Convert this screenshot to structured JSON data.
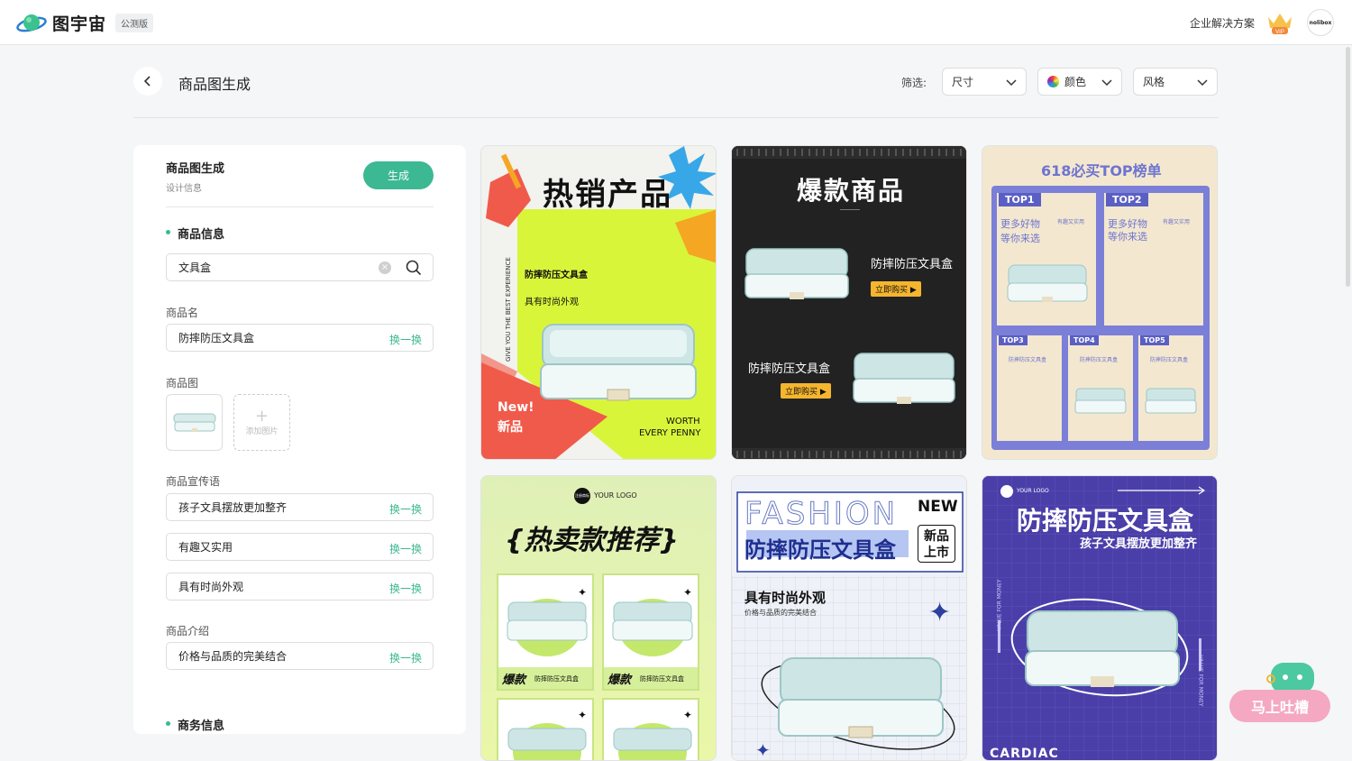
{
  "header": {
    "logo_text": "图宇宙",
    "beta_badge": "公测版",
    "enterprise_link": "企业解决方案",
    "vip_badge": "VIP",
    "avatar_text": "nolibox"
  },
  "toolbar": {
    "page_title": "商品图生成",
    "filter_label": "筛选:",
    "filters": [
      "尺寸",
      "颜色",
      "风格"
    ]
  },
  "panel": {
    "title": "商品图生成",
    "subtitle": "设计信息",
    "generate_label": "生成",
    "product_section": "商品信息",
    "search_value": "文具盒",
    "name_label": "商品名",
    "name_value": "防摔防压文具盒",
    "swap_label": "换一换",
    "image_label": "商品图",
    "add_image_label": "添加图片",
    "slogan_label": "商品宣传语",
    "slogans": [
      "孩子文具摆放更加整齐",
      "有趣又实用",
      "具有时尚外观"
    ],
    "intro_label": "商品介绍",
    "intro_value": "价格与品质的完美结合",
    "business_section": "商务信息"
  },
  "cards": {
    "c1": {
      "title": "热销产品",
      "vertical": "GIVE YOU THE BEST EXPERIENCE",
      "name": "防摔防压文具盒",
      "tagline": "具有时尚外观",
      "new_en": "New!",
      "new_cn": "新品",
      "worth1": "WORTH",
      "worth2": "EVERY PENNY"
    },
    "c2": {
      "title": "爆款商品",
      "name": "防摔防压文具盒",
      "buy": "立即购买 ▶"
    },
    "c3": {
      "title": "618必买TOP榜单",
      "top1": "TOP1",
      "top2": "TOP2",
      "top3": "TOP3",
      "top4": "TOP4",
      "top5": "TOP5",
      "slogan_a": "更多好物",
      "slogan_b": "等你来选",
      "tag": "有趣又实用",
      "name": "防摔防压文具盒"
    },
    "c4": {
      "logo": "YOUR LOGO",
      "logo_mark": "注册商标",
      "title": "{热卖款推荐}",
      "label_hot": "爆款",
      "name": "防摔防压文具盒"
    },
    "c5": {
      "fashion": "FASHION",
      "new_en": "NEW",
      "new1": "新品",
      "new2": "上市",
      "name": "防摔防压文具盒",
      "tagline": "具有时尚外观",
      "intro": "价格与品质的完美结合"
    },
    "c6": {
      "logo": "YOUR LOGO",
      "name": "防摔防压文具盒",
      "slogan": "孩子文具摆放更加整齐",
      "side": "VALUE FOR MONEY",
      "brand": "CARDIAC"
    }
  },
  "feedback": {
    "label": "马上吐槽"
  },
  "colors": {
    "accent": "#3cb892",
    "lime": "#d9f53a",
    "coral": "#f05a4a",
    "purple": "#4a3fa8",
    "top_blue": "#7b7fd8"
  }
}
